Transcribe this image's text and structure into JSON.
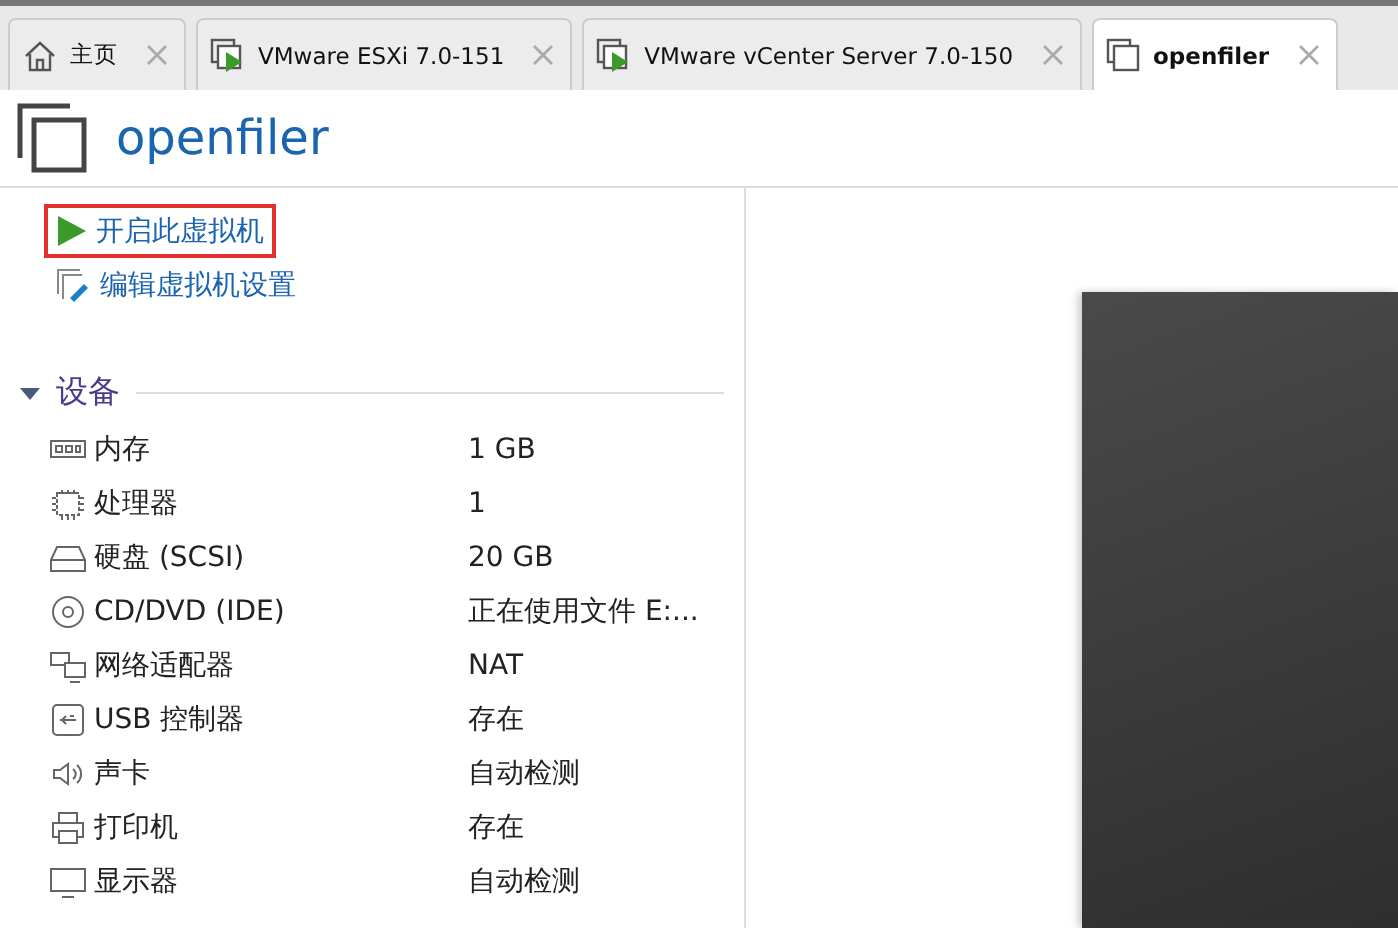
{
  "tabs": [
    {
      "label": "主页",
      "kind": "home",
      "selected": false
    },
    {
      "label": "VMware ESXi 7.0-151",
      "kind": "vm",
      "selected": false
    },
    {
      "label": "VMware vCenter Server 7.0-150",
      "kind": "vm",
      "selected": false
    },
    {
      "label": "openfiler",
      "kind": "vm_off",
      "selected": true
    }
  ],
  "header": {
    "title": "openfiler"
  },
  "actions": [
    {
      "label": "开启此虚拟机",
      "kind": "power_on",
      "highlighted": true
    },
    {
      "label": "编辑虚拟机设置",
      "kind": "edit",
      "highlighted": false
    }
  ],
  "devices": {
    "title": "设备",
    "expanded": true,
    "items": [
      {
        "kind": "memory",
        "name": "内存",
        "value": "1 GB"
      },
      {
        "kind": "cpu",
        "name": "处理器",
        "value": "1"
      },
      {
        "kind": "disk",
        "name": "硬盘 (SCSI)",
        "value": "20 GB"
      },
      {
        "kind": "cdrom",
        "name": "CD/DVD (IDE)",
        "value": "正在使用文件 E:..."
      },
      {
        "kind": "network",
        "name": "网络适配器",
        "value": "NAT"
      },
      {
        "kind": "usb",
        "name": "USB 控制器",
        "value": "存在"
      },
      {
        "kind": "sound",
        "name": "声卡",
        "value": "自动检测"
      },
      {
        "kind": "printer",
        "name": "打印机",
        "value": "存在"
      },
      {
        "kind": "display",
        "name": "显示器",
        "value": "自动检测"
      }
    ]
  }
}
